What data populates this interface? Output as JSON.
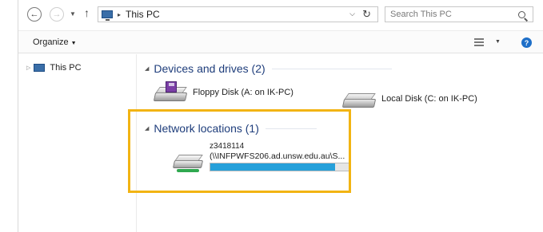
{
  "address_bar": {
    "back_icon": "back-arrow-icon",
    "forward_icon": "forward-arrow-icon",
    "recent_icon": "chevron-down-icon",
    "up_icon": "up-arrow-icon",
    "location_icon": "this-pc-icon",
    "separator": "▸",
    "location": "This PC",
    "refresh_icon": "refresh-icon"
  },
  "search": {
    "placeholder": "Search This PC",
    "icon": "search-icon"
  },
  "toolbar": {
    "organize_label": "Organize",
    "view_icon": "change-view-icon",
    "help_icon": "help-icon"
  },
  "nav_pane": {
    "items": [
      {
        "label": "This PC",
        "icon": "this-pc-icon",
        "expanded": false
      }
    ]
  },
  "content": {
    "groups": [
      {
        "title": "Devices and drives (2)",
        "items": [
          {
            "label": "Floppy Disk (A: on IK-PC)",
            "icon": "floppy-drive-icon"
          },
          {
            "label": "Local Disk (C: on IK-PC)",
            "icon": "local-disk-icon"
          }
        ]
      },
      {
        "title": "Network locations (1)",
        "items": [
          {
            "name": "z3418114",
            "path": "(\\\\INFPWFS206.ad.unsw.edu.au\\S...",
            "icon": "network-drive-icon",
            "usage_fraction": 0.9
          }
        ]
      }
    ]
  },
  "colors": {
    "highlight": "#f2b413",
    "group_title": "#1e3d7b",
    "usage_bar": "#26a0da"
  }
}
